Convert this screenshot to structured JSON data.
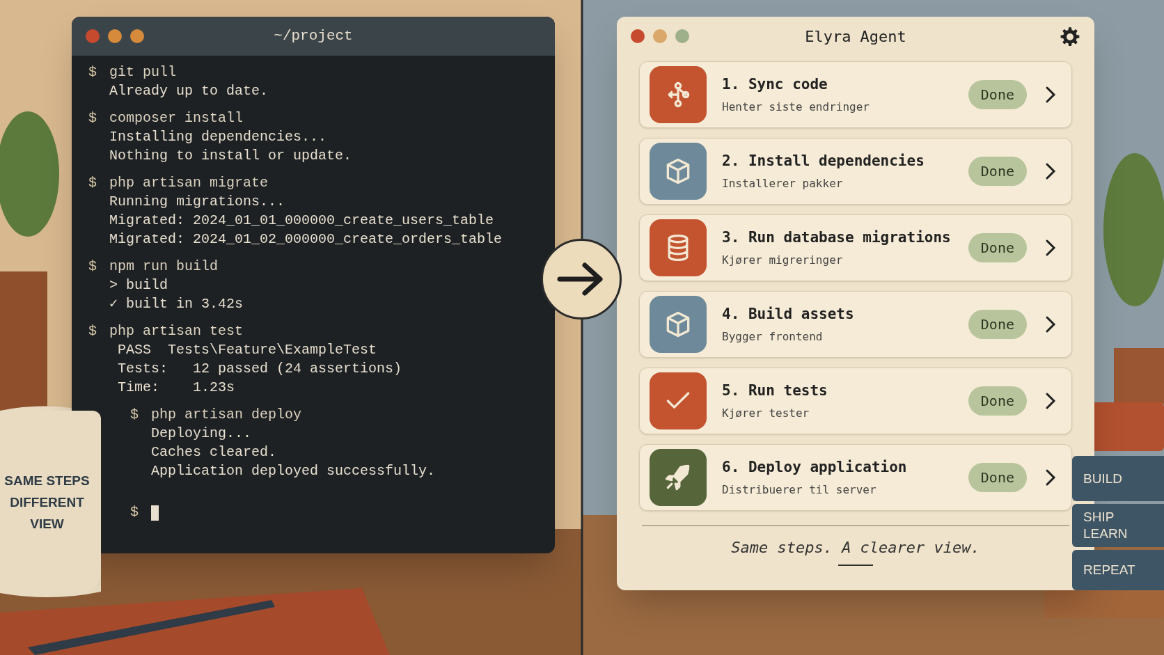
{
  "terminal": {
    "title": "~/project",
    "blocks": [
      {
        "nested": false,
        "lines": [
          {
            "kind": "prompt",
            "prompt": "$",
            "text": "git pull"
          },
          {
            "kind": "output",
            "text": "Already up to date."
          }
        ]
      },
      {
        "nested": false,
        "lines": [
          {
            "kind": "prompt",
            "prompt": "$",
            "text": "composer install"
          },
          {
            "kind": "output",
            "text": "Installing dependencies..."
          },
          {
            "kind": "output",
            "text": "Nothing to install or update."
          }
        ]
      },
      {
        "nested": false,
        "lines": [
          {
            "kind": "prompt",
            "prompt": "$",
            "text": "php artisan migrate"
          },
          {
            "kind": "output",
            "text": "Running migrations..."
          },
          {
            "kind": "output",
            "text": "Migrated: 2024_01_01_000000_create_users_table"
          },
          {
            "kind": "output",
            "text": "Migrated: 2024_01_02_000000_create_orders_table"
          }
        ]
      },
      {
        "nested": false,
        "lines": [
          {
            "kind": "prompt",
            "prompt": "$",
            "text": "npm run build"
          },
          {
            "kind": "output",
            "text": "> build"
          },
          {
            "kind": "output",
            "text": "✓ built in 3.42s"
          }
        ]
      },
      {
        "nested": false,
        "lines": [
          {
            "kind": "prompt",
            "prompt": "$",
            "text": "php artisan test"
          },
          {
            "kind": "output",
            "text": " PASS  Tests\\Feature\\ExampleTest"
          },
          {
            "kind": "output",
            "text": " Tests:   12 passed (24 assertions)"
          },
          {
            "kind": "output",
            "text": " Time:    1.23s"
          }
        ]
      },
      {
        "nested": true,
        "lines": [
          {
            "kind": "prompt",
            "prompt": "$",
            "text": "php artisan deploy"
          },
          {
            "kind": "output",
            "text": "Deploying..."
          },
          {
            "kind": "output",
            "text": "Caches cleared."
          },
          {
            "kind": "output",
            "text": "Application deployed successfully."
          }
        ]
      },
      {
        "nested": true,
        "lines": [
          {
            "kind": "cursor",
            "prompt": "$"
          }
        ]
      }
    ]
  },
  "agent": {
    "title": "Elyra Agent",
    "steps": [
      {
        "kind": "branch",
        "color": "#c4532f",
        "title": "1. Sync code",
        "subtitle": "Henter siste endringer",
        "status": "Done"
      },
      {
        "kind": "box",
        "color": "#6e8a9a",
        "title": "2. Install dependencies",
        "subtitle": "Installerer pakker",
        "status": "Done"
      },
      {
        "kind": "database",
        "color": "#c4532f",
        "title": "3. Run database migrations",
        "subtitle": "Kjører migreringer",
        "status": "Done"
      },
      {
        "kind": "box",
        "color": "#6e8a9a",
        "title": "4. Build assets",
        "subtitle": "Bygger frontend",
        "status": "Done"
      },
      {
        "kind": "check",
        "color": "#c4532f",
        "title": "5. Run tests",
        "subtitle": "Kjører tester",
        "status": "Done"
      },
      {
        "kind": "rocket",
        "color": "#56653a",
        "title": "6. Deploy application",
        "subtitle": "Distribuerer til server",
        "status": "Done"
      }
    ],
    "footer": "Same steps. A clearer view."
  },
  "mug_label": "SAME STEPS DIFFERENT VIEW",
  "book_labels": [
    "BUILD",
    "SHIP LEARN",
    "REPEAT"
  ]
}
